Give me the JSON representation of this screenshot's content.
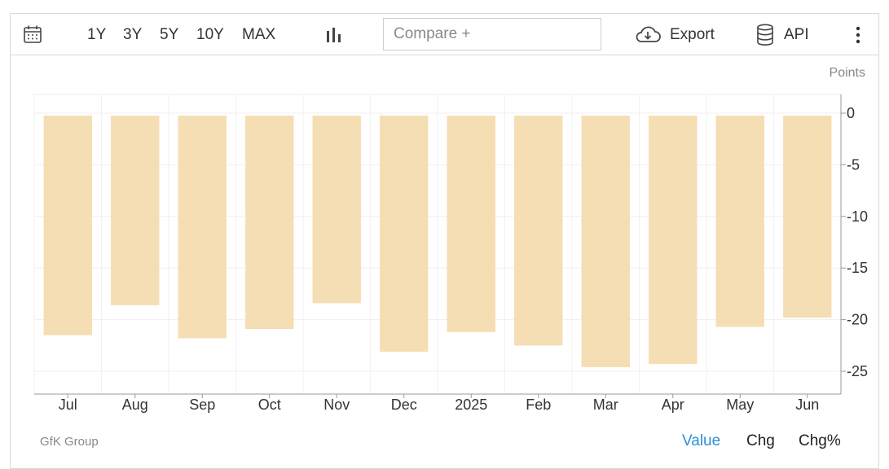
{
  "toolbar": {
    "ranges": [
      "1Y",
      "3Y",
      "5Y",
      "10Y",
      "MAX"
    ],
    "compare_placeholder": "Compare +",
    "export_label": "Export",
    "api_label": "API",
    "icons": [
      "calendar-icon",
      "bar-chart-icon",
      "cloud-download-icon",
      "database-icon",
      "more-vertical-icon"
    ]
  },
  "chart_data": {
    "type": "bar",
    "categories": [
      "Jul",
      "Aug",
      "Sep",
      "Oct",
      "Nov",
      "Dec",
      "2025",
      "Feb",
      "Mar",
      "Apr",
      "May",
      "Jun"
    ],
    "values": [
      -21.5,
      -18.6,
      -21.8,
      -20.9,
      -18.4,
      -23.1,
      -21.2,
      -22.5,
      -24.6,
      -24.3,
      -20.7,
      -19.8
    ],
    "ylabel": "Points",
    "yticks": [
      0,
      -5,
      -10,
      -15,
      -20,
      -25
    ],
    "ylim": [
      -27,
      2
    ],
    "axis_position": "right",
    "grid": true,
    "bar_color": "#f5deb3"
  },
  "footer": {
    "source": "GfK Group",
    "tabs": [
      "Value",
      "Chg",
      "Chg%"
    ],
    "active_tab": "Value"
  }
}
